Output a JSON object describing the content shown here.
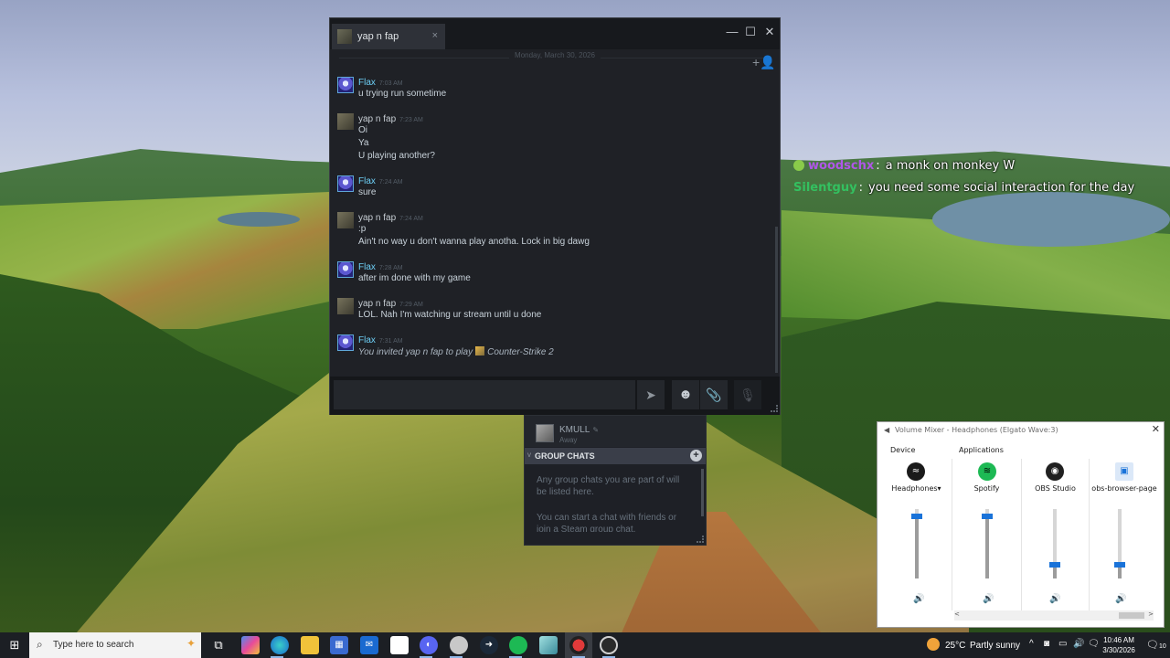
{
  "colors": {
    "steam_bg": "#1f2126",
    "flax_name": "#6dcff6",
    "overlay_user1": "#b057e8",
    "overlay_user2": "#33c060",
    "accent_blue": "#1a73d9"
  },
  "overlay_chat": [
    {
      "user": "woodschx",
      "sep": ":",
      "message": "a monk on monkey W",
      "color": "#b057e8",
      "badge": true
    },
    {
      "user": "Silentguy",
      "sep": ":",
      "message": "you need some social interaction for the day",
      "color": "#33c060",
      "badge": false
    }
  ],
  "steam_chat": {
    "tab_title": "yap n fap",
    "tab_close": "×",
    "window_controls": {
      "minimize": "—",
      "maximize": "☐",
      "close": "✕"
    },
    "date_divider": "Monday, March 30, 2026",
    "add_friend_icon": "+👤",
    "messages": [
      {
        "author": "Flax",
        "time": "7:03 AM",
        "lines": [
          "u trying run sometime"
        ]
      },
      {
        "author": "yap n fap",
        "time": "7:23 AM",
        "lines": [
          "Oi",
          "Ya",
          "U playing another?"
        ]
      },
      {
        "author": "Flax",
        "time": "7:24 AM",
        "lines": [
          "sure"
        ]
      },
      {
        "author": "yap n fap",
        "time": "7:24 AM",
        "lines": [
          ":p",
          "Ain't no way u don't wanna play anotha. Lock in big dawg"
        ]
      },
      {
        "author": "Flax",
        "time": "7:28 AM",
        "lines": [
          "after im done with my game"
        ]
      },
      {
        "author": "yap n fap",
        "time": "7:29 AM",
        "lines": [
          "LOL. Nah I'm watching ur stream until u done"
        ]
      },
      {
        "author": "Flax",
        "time": "7:31 AM",
        "invite": {
          "text": "You invited yap n fap to play",
          "game": "Counter-Strike 2"
        }
      }
    ],
    "composer": {
      "placeholder": "",
      "send_icon": "➤",
      "emoji_icon": "☻",
      "attach_icon": "📎",
      "voice_icon": "🎙"
    }
  },
  "friends_panel": {
    "friend": {
      "name": "KMULL",
      "edit_icon": "✎",
      "status": "Away"
    },
    "group_header": "GROUP CHATS",
    "group_chevron": "v",
    "group_add": "+",
    "group_text_1": "Any group chats you are part of will be listed here.",
    "group_text_2": "You can start a chat with friends or join a Steam group chat."
  },
  "volume_mixer": {
    "title": "Volume Mixer - Headphones (Elgato Wave:3)",
    "close": "✕",
    "device_label": "Device",
    "applications_label": "Applications",
    "device": {
      "name": "Headphones",
      "dropdown": "▾",
      "level": 0.9
    },
    "apps": [
      {
        "name": "Spotify",
        "level": 0.9,
        "icon": "spotify-icon"
      },
      {
        "name": "OBS Studio",
        "level": 0.2,
        "icon": "obs-icon"
      },
      {
        "name": "obs-browser-page",
        "level": 0.2,
        "icon": "browser-page-icon"
      }
    ],
    "speaker_glyph": "🔊",
    "scroll_left": "<",
    "scroll_right": ">"
  },
  "taskbar": {
    "start_glyph": "⊞",
    "search_placeholder": "Type here to search",
    "search_icon": "⌕",
    "search_deco": "✦",
    "weather_temp": "25°C",
    "weather_cond": "Partly sunny",
    "time": "10:46 AM",
    "date": "3/30/2026",
    "notif_glyph": "🗨",
    "notif_count": "10",
    "tray": [
      "^",
      "◙",
      "▭",
      "🔊",
      "🗨"
    ]
  }
}
